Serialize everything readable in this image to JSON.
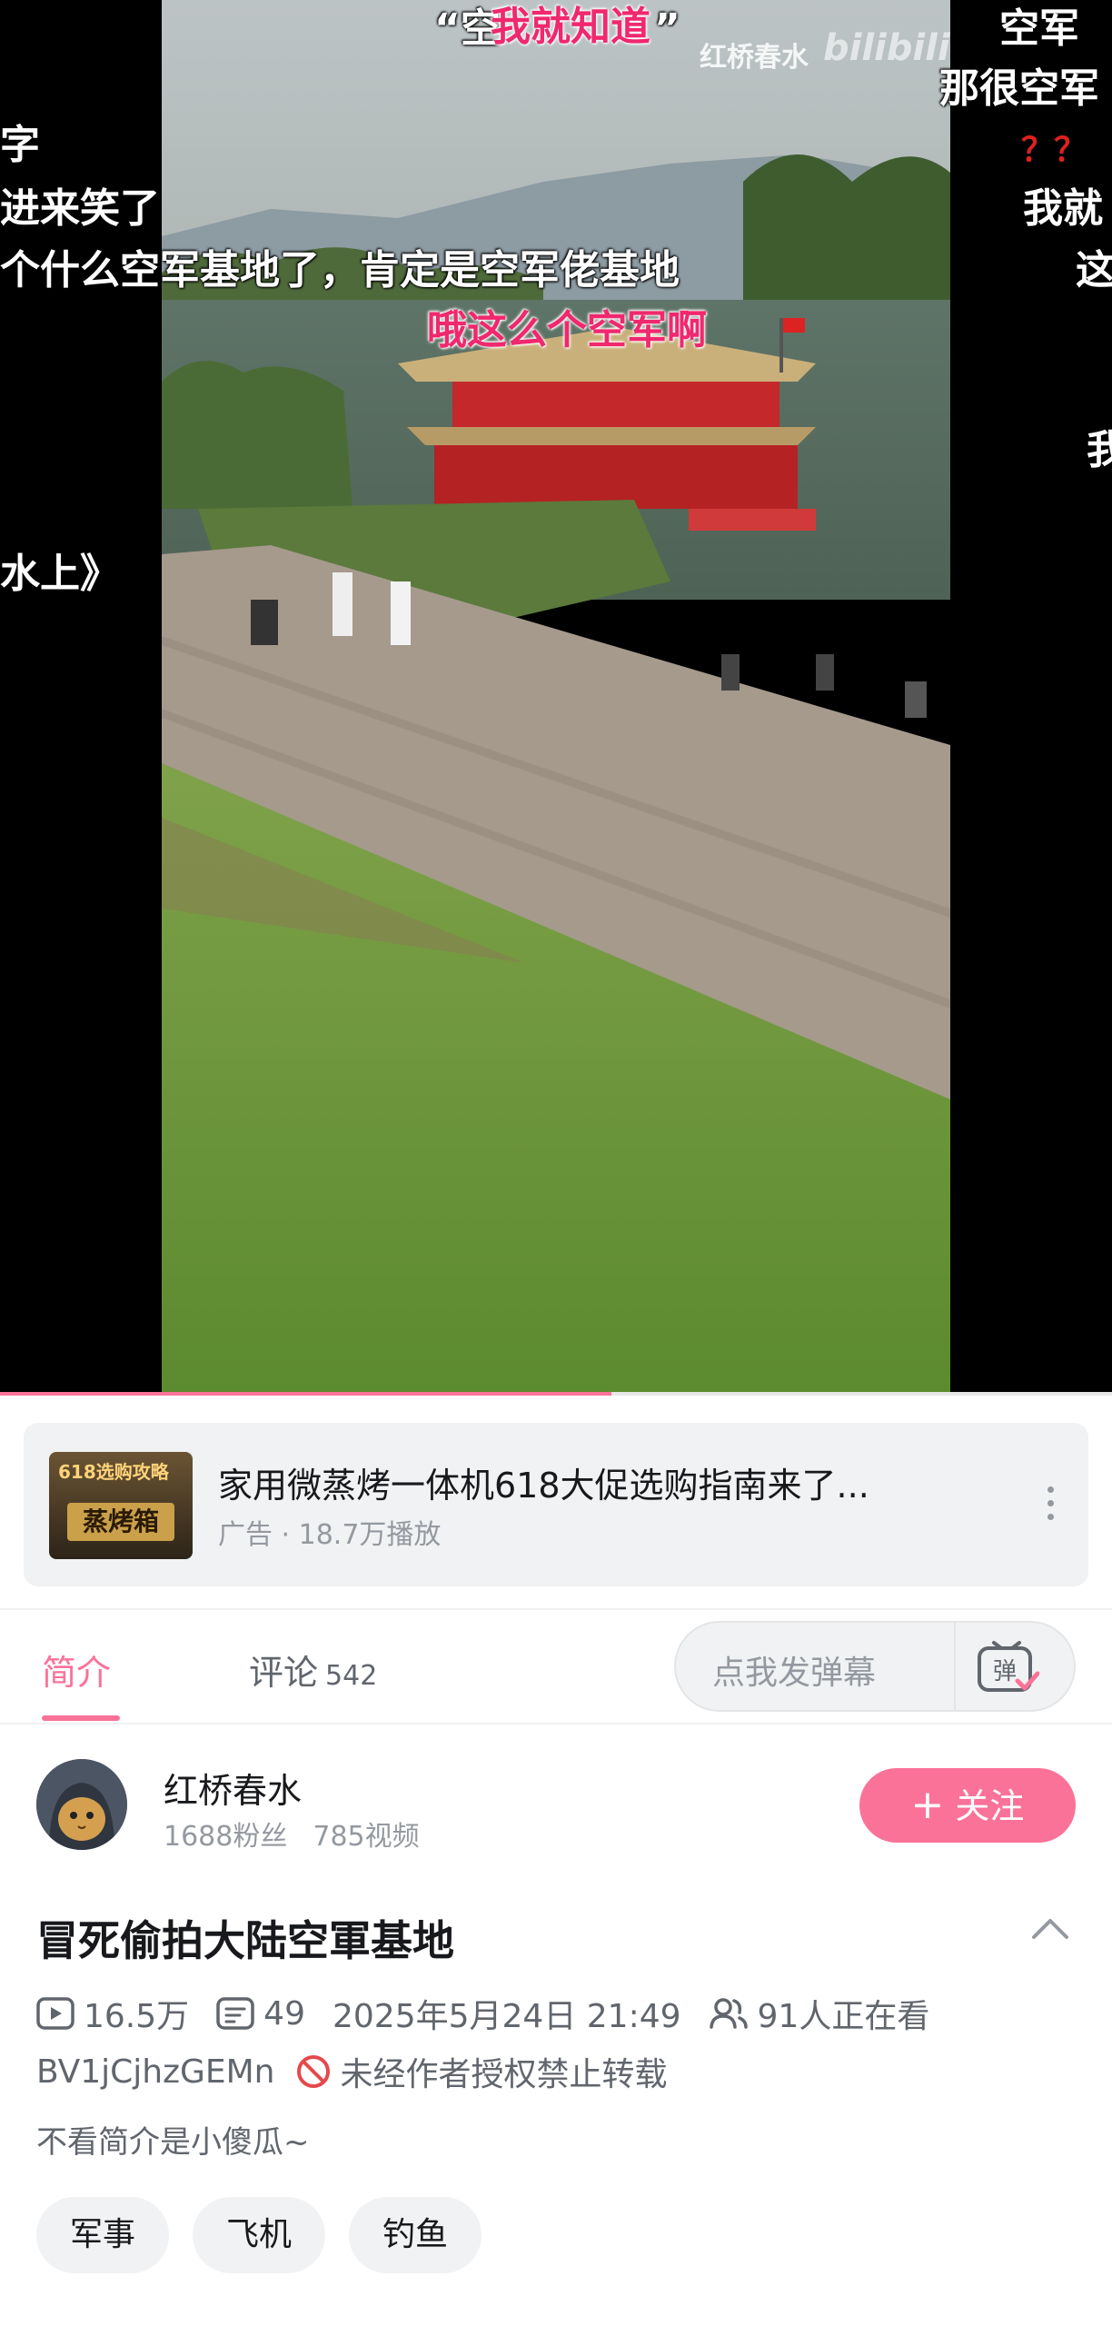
{
  "video": {
    "watermark": "红桥春水",
    "watermark_logo": "bilibili",
    "progress": 0.55,
    "danmaku": [
      {
        "text": "“空",
        "style": "white"
      },
      {
        "text": "我就知道",
        "style": "pink"
      },
      {
        "text": "”",
        "style": "white"
      },
      {
        "text": "字",
        "style": "white"
      },
      {
        "text": "进来笑了",
        "style": "white"
      },
      {
        "text": "个什么空军基地了，肯定是空军佬基地",
        "style": "white"
      },
      {
        "text": "哦这么个空军啊",
        "style": "pink"
      },
      {
        "text": "水上》",
        "style": "white"
      },
      {
        "text": "空军",
        "style": "white"
      },
      {
        "text": "那很空军",
        "style": "white"
      },
      {
        "text": "？？",
        "style": "red"
      },
      {
        "text": "我就",
        "style": "white"
      },
      {
        "text": "这",
        "style": "white"
      },
      {
        "text": "我",
        "style": "white"
      }
    ]
  },
  "ad": {
    "thumb_top": "618选购攻略",
    "thumb_main": "蒸烤箱",
    "title": "家用微蒸烤一体机618大促选购指南来了...",
    "meta": "广告 · 18.7万播放"
  },
  "tabs": {
    "intro": "简介",
    "comments": "评论",
    "comments_count": "542",
    "danmaku_placeholder": "点我发弹幕",
    "danmaku_icon_label": "弹"
  },
  "uploader": {
    "name": "红桥春水",
    "fans": "1688粉丝",
    "videos": "785视频",
    "follow_label": "关注"
  },
  "info": {
    "title": "冒死偷拍大陆空軍基地",
    "views": "16.5万",
    "danmaku_count": "49",
    "date": "2025年5月24日 21:49",
    "watching": "91人正在看",
    "bvid": "BV1jCjhzGEMn",
    "no_repost": "未经作者授权禁止转载",
    "description": "不看简介是小傻瓜~"
  },
  "tags": [
    "军事",
    "飞机",
    "钓鱼"
  ],
  "colors": {
    "accent": "#fb7299",
    "danmaku_pink": "#f0286e"
  }
}
